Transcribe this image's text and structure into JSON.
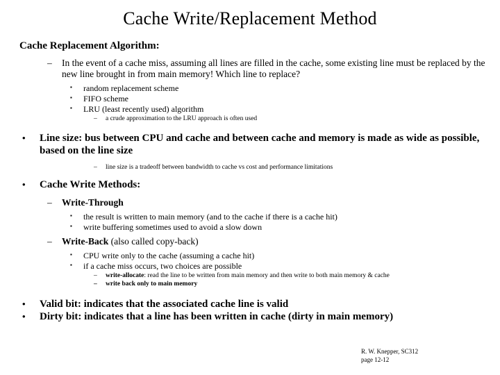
{
  "slide": {
    "title": "Cache Write/Replacement Method",
    "background_color": "#ffffff",
    "text_color": "#000000",
    "bullets": {
      "dot": "•",
      "dash": "–",
      "square": "▪"
    }
  },
  "content": {
    "heading_replacement": "Cache Replacement Algorithm:",
    "replacement_detail": "In the event of a cache miss, assuming all lines are filled in the cache, some existing line must be replaced by the new line brought in from main memory!  Which line to replace?",
    "scheme_random": "random replacement scheme",
    "scheme_fifo": "FIFO scheme",
    "scheme_lru": "LRU (least recently used) algorithm",
    "scheme_lru_note": "a crude approximation to the LRU approach is often used",
    "line_size": "Line size:  bus between CPU and cache and between cache and memory is made as wide as possible, based on the line size",
    "line_size_note": "line size is a tradeoff between bandwidth to cache vs cost and performance limitations",
    "heading_write_methods": "Cache Write Methods:",
    "write_through_label": "Write-Through",
    "write_through_item1": "the result is written to main memory (and to the cache if there is a cache hit)",
    "write_through_item2": "write buffering sometimes used to avoid a slow down",
    "write_back_label": "Write-Back",
    "write_back_suffix": " (also called copy-back)",
    "write_back_item1": "CPU write only to the cache (assuming a cache hit)",
    "write_back_item2": "if a cache miss occurs, two choices are possible",
    "write_allocate_label": "write-allocate",
    "write_allocate_rest": ": read the line to be written from main memory and then write to both main memory & cache",
    "write_back_only": "write back only to main memory",
    "valid_bit": "Valid bit:  indicates that the associated cache line is valid",
    "dirty_bit": "Dirty bit:  indicates that a line has been written in cache (dirty in main memory)"
  },
  "footer": {
    "author": "R. W. Knepper, SC312",
    "page": "page 12-12"
  }
}
